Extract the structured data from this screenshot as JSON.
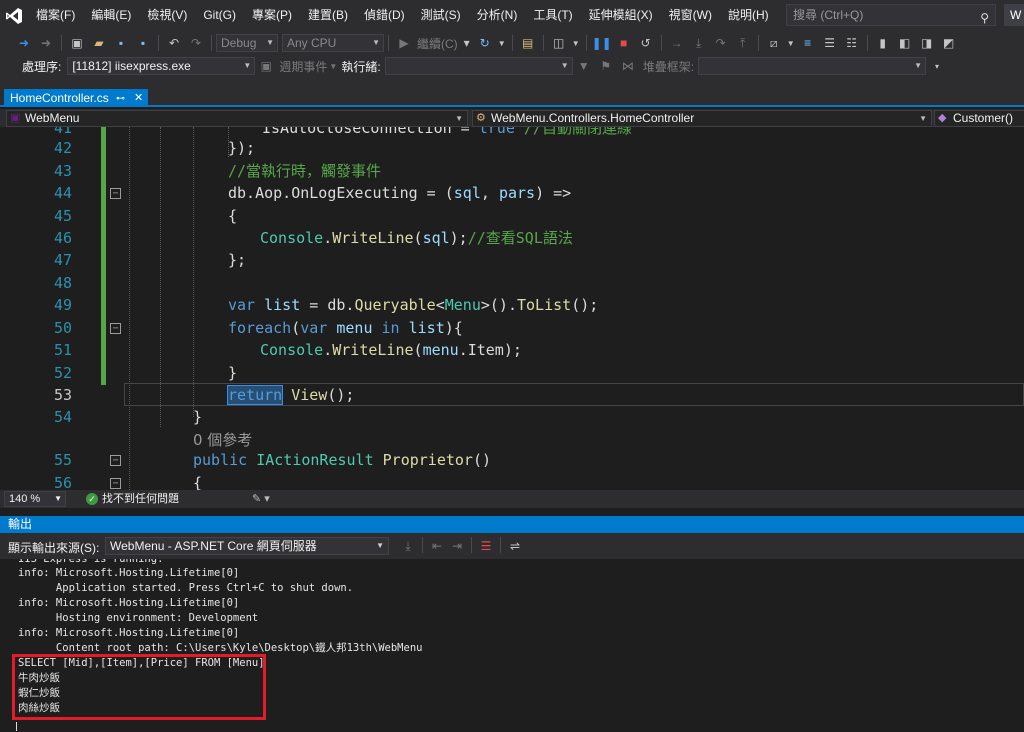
{
  "menubar": {
    "items": [
      "檔案(F)",
      "編輯(E)",
      "檢視(V)",
      "Git(G)",
      "專案(P)",
      "建置(B)",
      "偵錯(D)",
      "測試(S)",
      "分析(N)",
      "工具(T)",
      "延伸模組(X)",
      "視窗(W)",
      "說明(H)"
    ],
    "search_placeholder": "搜尋 (Ctrl+Q)",
    "user_initial": "W"
  },
  "toolbar": {
    "config": "Debug",
    "platform": "Any CPU",
    "continue_label": "繼續(C)"
  },
  "toolbar2": {
    "process_label": "處理序:",
    "process_value": "[11812] iisexpress.exe",
    "lifecycle_label": "週期事件",
    "thread_label": "執行緒:",
    "stackframe_label": "堆疊框架:"
  },
  "tab": {
    "filename": "HomeController.cs",
    "pin": "⊷",
    "close": "✕"
  },
  "navbar": {
    "project": "WebMenu",
    "class_path": "WebMenu.Controllers.HomeController",
    "member": "Customer()"
  },
  "editor": {
    "line_numbers": [
      "41",
      "42",
      "43",
      "44",
      "45",
      "46",
      "47",
      "48",
      "49",
      "50",
      "51",
      "52",
      "53",
      "54",
      "",
      "55",
      "56"
    ],
    "references_text": "0 個參考",
    "zoom": "140 %",
    "issues_text": "找不到任何問題"
  },
  "output": {
    "title": "輸出",
    "source_label": "顯示輸出來源(S):",
    "source_value": "WebMenu - ASP.NET Core 網頁伺服器",
    "lines": [
      "IIS Express is running.",
      "info: Microsoft.Hosting.Lifetime[0]",
      "      Application started. Press Ctrl+C to shut down.",
      "info: Microsoft.Hosting.Lifetime[0]",
      "      Hosting environment: Development",
      "info: Microsoft.Hosting.Lifetime[0]",
      "      Content root path: C:\\Users\\Kyle\\Desktop\\鐵人邦13th\\WebMenu",
      "SELECT [Mid],[Item],[Price] FROM [Menu]",
      "牛肉炒飯",
      "蝦仁炒飯",
      "肉絲炒飯"
    ]
  },
  "colors": {
    "accent": "#007acc",
    "keyword": "#569cd6",
    "comment": "#57a64a",
    "type": "#4ec9b0",
    "method": "#dcdcaa",
    "highlight_box": "#e51b2a"
  }
}
